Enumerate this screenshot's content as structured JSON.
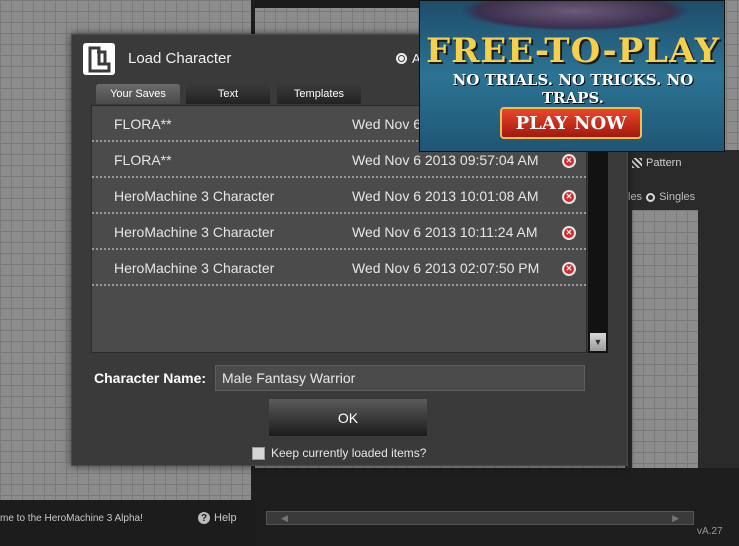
{
  "dialog": {
    "title": "Load Character",
    "all_option": "A",
    "tabs": [
      {
        "label": "Your Saves",
        "active": true
      },
      {
        "label": "Text",
        "active": false
      },
      {
        "label": "Templates",
        "active": false
      }
    ],
    "saves": [
      {
        "name": "FLORA**",
        "date": "Wed Nov 6"
      },
      {
        "name": "FLORA**",
        "date": "Wed Nov 6 2013 09:57:04 AM"
      },
      {
        "name": "HeroMachine 3 Character",
        "date": "Wed Nov 6 2013 10:01:08 AM"
      },
      {
        "name": "HeroMachine 3 Character",
        "date": "Wed Nov 6 2013 10:11:24 AM"
      },
      {
        "name": "HeroMachine 3 Character",
        "date": "Wed Nov 6 2013 02:07:50 PM"
      }
    ],
    "character_name_label": "Character Name:",
    "character_name_value": "Male Fantasy Warrior",
    "ok_label": "OK",
    "keep_items_label": "Keep currently loaded items?",
    "keep_items_checked": false
  },
  "ad": {
    "title": "FREE-TO-PLAY",
    "subtitle": "NO TRIALS. NO TRICKS. NO TRAPS.",
    "button": "PLAY NOW"
  },
  "background": {
    "pattern_label": "Pattern",
    "singles_prefix": "les",
    "singles_label": "Singles",
    "welcome": "me to the HeroMachine 3 Alpha!",
    "help_label": "Help",
    "version": "vA.27"
  }
}
